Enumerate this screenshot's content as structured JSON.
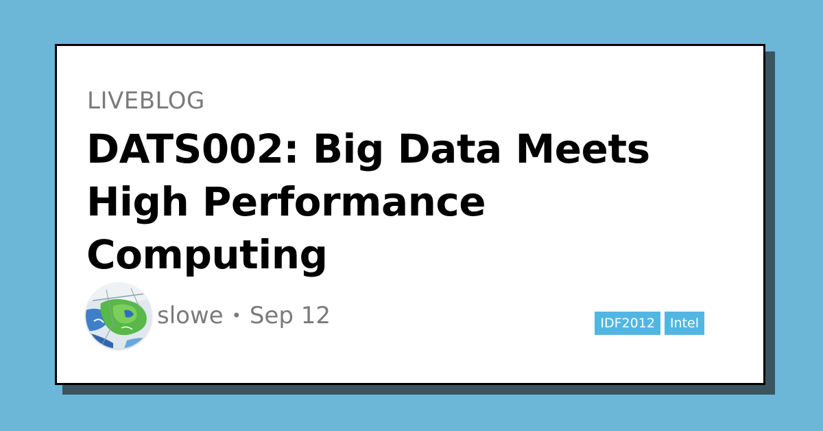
{
  "page": {
    "background_color": "#6cb6d8"
  },
  "post": {
    "kicker": "LIVEBLOG",
    "title": "DATS002: Big Data Meets High Performance Computing",
    "author": "slowe",
    "separator": "•",
    "date": "Sep 12",
    "avatar_icon": "map-avatar-icon",
    "tags": [
      {
        "label": "IDF2012"
      },
      {
        "label": "Intel"
      }
    ],
    "tag_color": "#52b6e2"
  }
}
